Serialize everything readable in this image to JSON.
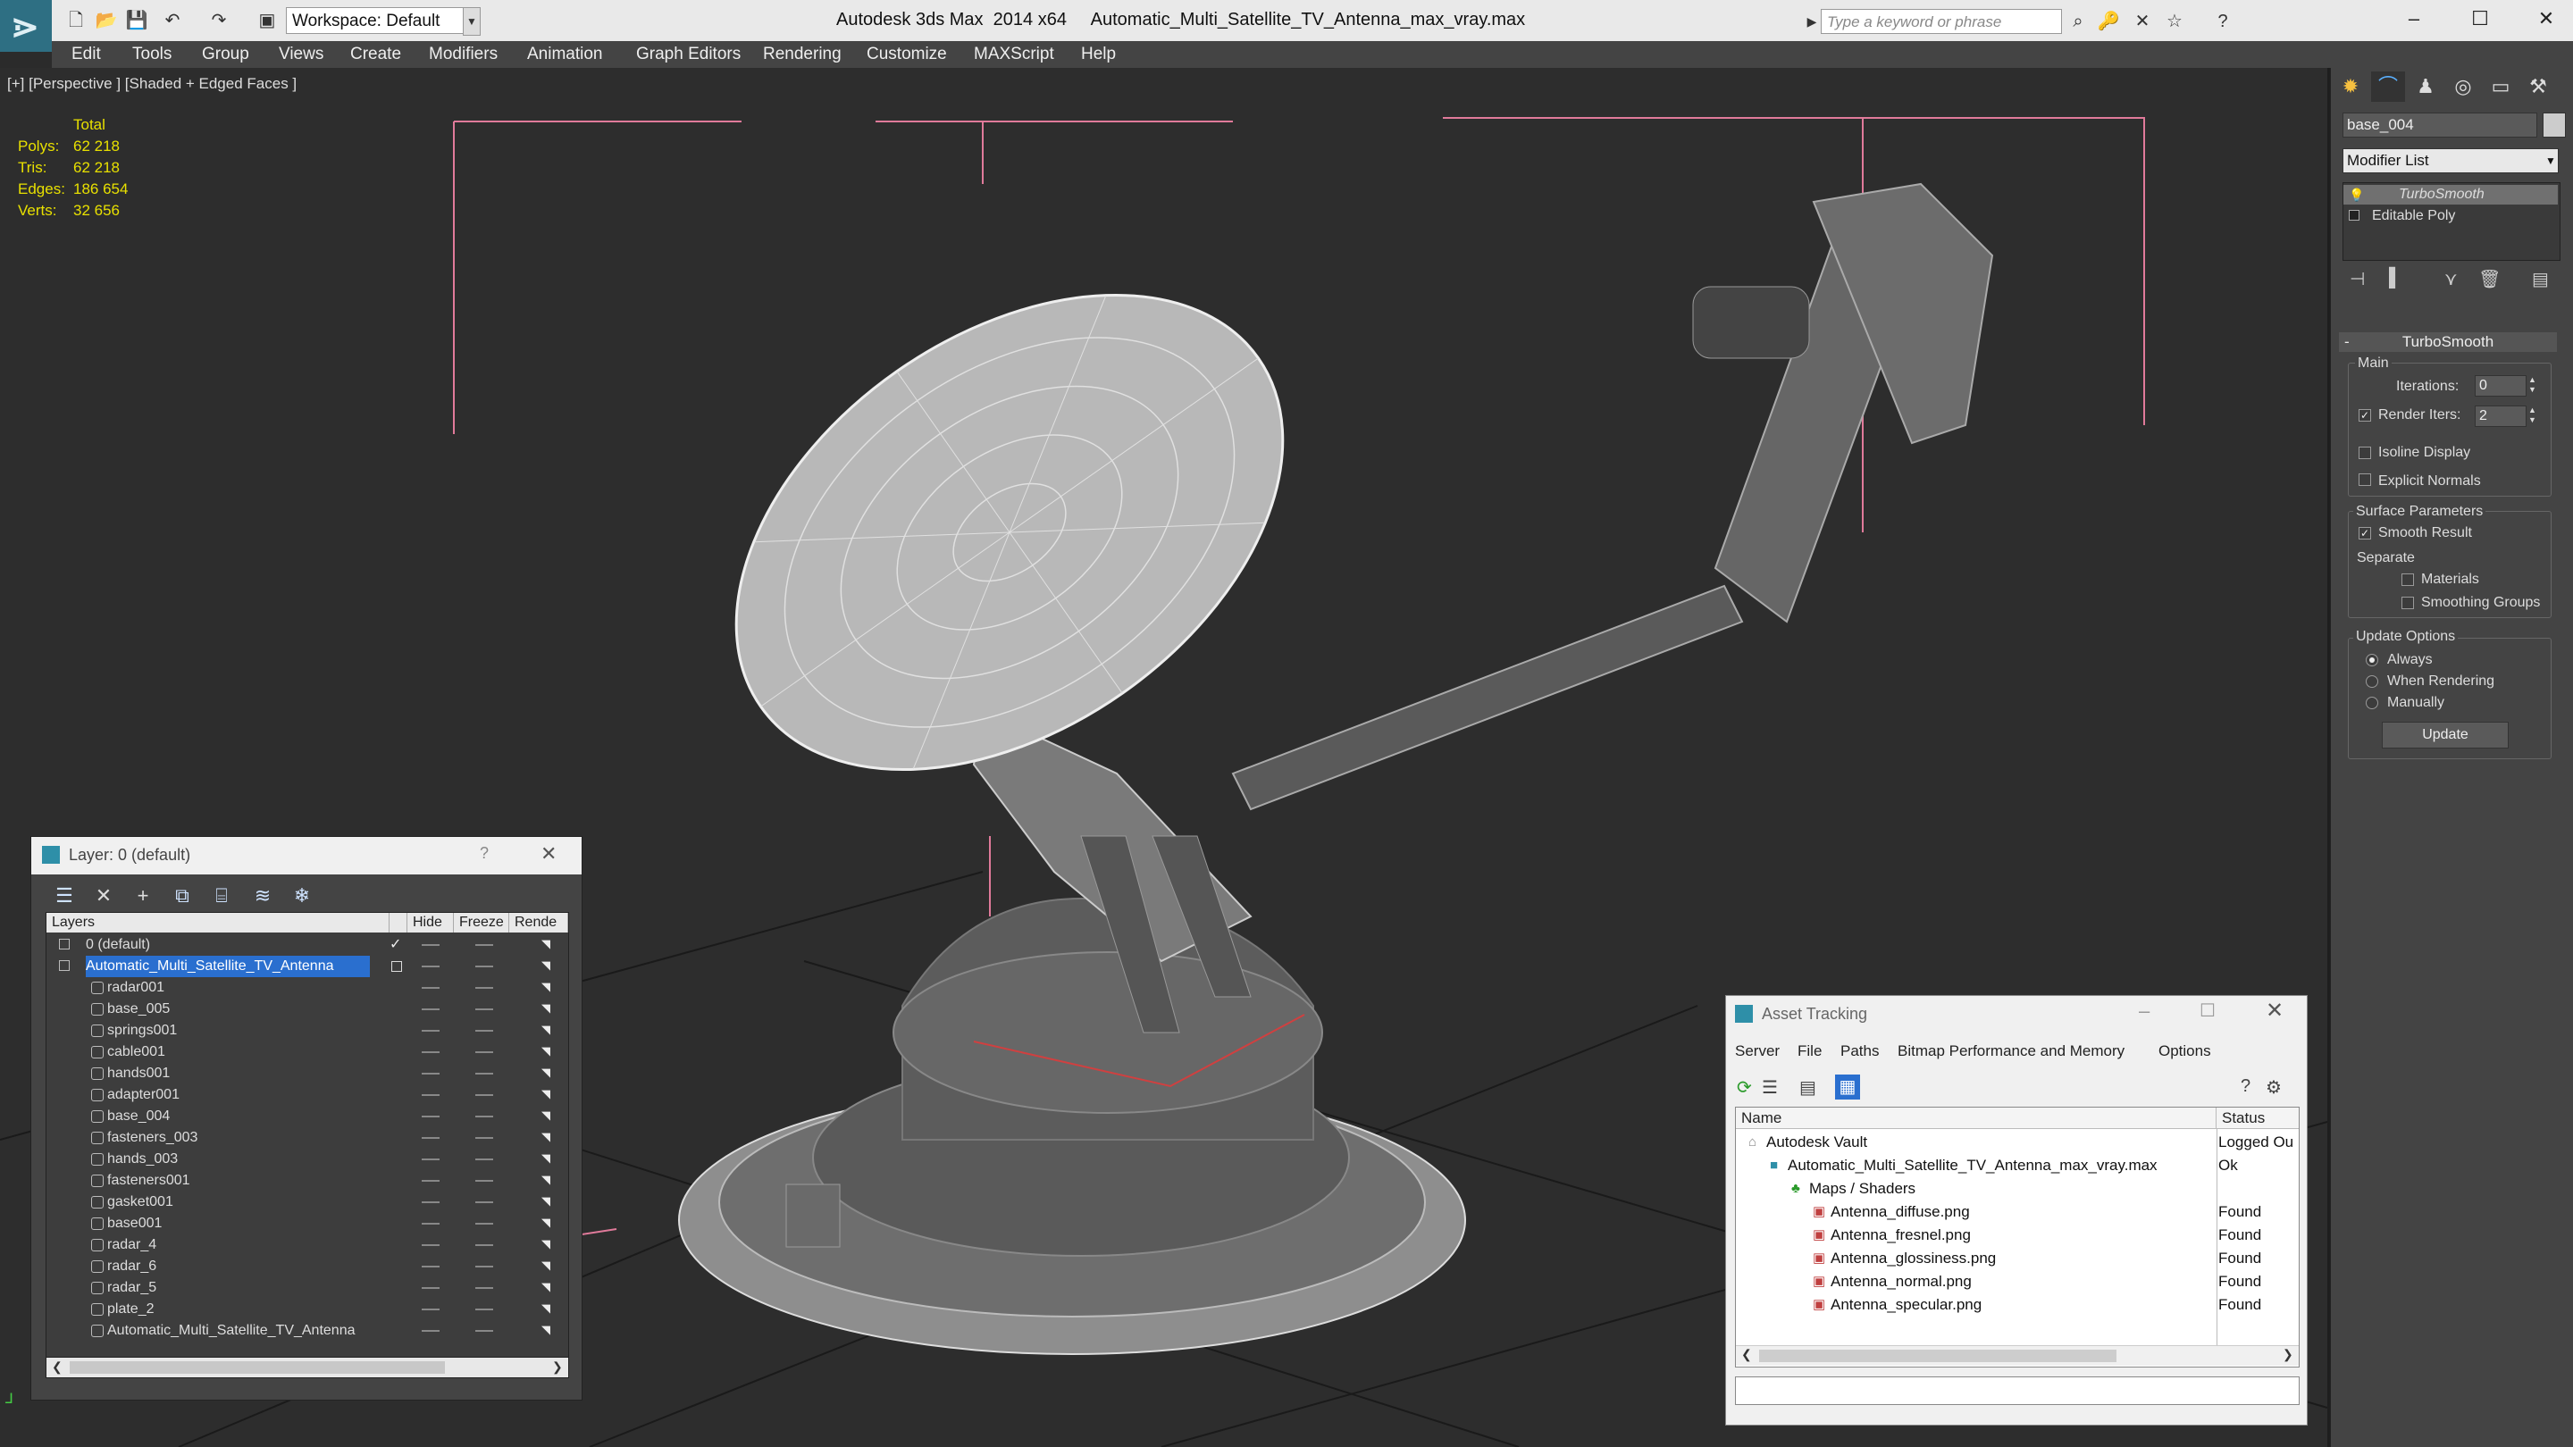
{
  "window": {
    "app_title": "Autodesk 3ds Max  2014 x64",
    "file_title": "Automatic_Multi_Satellite_TV_Antenna_max_vray.max",
    "workspace": "Workspace: Default",
    "search_placeholder": "Type a keyword or phrase"
  },
  "menu": [
    "Edit",
    "Tools",
    "Group",
    "Views",
    "Create",
    "Modifiers",
    "Animation",
    "Graph Editors",
    "Rendering",
    "Customize",
    "MAXScript",
    "Help"
  ],
  "viewport": {
    "label": "[+] [Perspective ] [Shaded + Edged Faces ]",
    "stats": {
      "header": "Total",
      "rows": [
        {
          "k": "Polys:",
          "v": "62 218"
        },
        {
          "k": "Tris:",
          "v": "62 218"
        },
        {
          "k": "Edges:",
          "v": "186 654"
        },
        {
          "k": "Verts:",
          "v": "32 656"
        }
      ]
    }
  },
  "command_panel": {
    "object_name": "base_004",
    "modifier_list": "Modifier List",
    "stack": [
      "TurboSmooth",
      "Editable Poly"
    ],
    "rollout_title": "TurboSmooth",
    "main_group": "Main",
    "iterations_label": "Iterations:",
    "iterations_value": "0",
    "render_iters_label": "Render Iters:",
    "render_iters_value": "2",
    "isoline": "Isoline Display",
    "explicit_normals": "Explicit Normals",
    "surface_params": "Surface Parameters",
    "smooth_result": "Smooth Result",
    "separate": "Separate",
    "materials": "Materials",
    "smoothing_groups": "Smoothing Groups",
    "update_options": "Update Options",
    "always": "Always",
    "when_rendering": "When Rendering",
    "manually": "Manually",
    "update_button": "Update"
  },
  "layer_dialog": {
    "title": "Layer: 0 (default)",
    "help": "?",
    "columns": [
      "Layers",
      "Hide",
      "Freeze",
      "Rende"
    ],
    "layers": [
      {
        "name": "0 (default)",
        "indent": 0,
        "type": "layer",
        "checked": true
      },
      {
        "name": "Automatic_Multi_Satellite_TV_Antenna",
        "indent": 0,
        "type": "layer",
        "selected": true
      },
      {
        "name": "radar001",
        "indent": 1,
        "type": "object"
      },
      {
        "name": "base_005",
        "indent": 1,
        "type": "object"
      },
      {
        "name": "springs001",
        "indent": 1,
        "type": "object"
      },
      {
        "name": "cable001",
        "indent": 1,
        "type": "object"
      },
      {
        "name": "hands001",
        "indent": 1,
        "type": "object"
      },
      {
        "name": "adapter001",
        "indent": 1,
        "type": "object"
      },
      {
        "name": "base_004",
        "indent": 1,
        "type": "object"
      },
      {
        "name": "fasteners_003",
        "indent": 1,
        "type": "object"
      },
      {
        "name": "hands_003",
        "indent": 1,
        "type": "object"
      },
      {
        "name": "fasteners001",
        "indent": 1,
        "type": "object"
      },
      {
        "name": "gasket001",
        "indent": 1,
        "type": "object"
      },
      {
        "name": "base001",
        "indent": 1,
        "type": "object"
      },
      {
        "name": "radar_4",
        "indent": 1,
        "type": "object"
      },
      {
        "name": "radar_6",
        "indent": 1,
        "type": "object"
      },
      {
        "name": "radar_5",
        "indent": 1,
        "type": "object"
      },
      {
        "name": "plate_2",
        "indent": 1,
        "type": "object"
      },
      {
        "name": "Automatic_Multi_Satellite_TV_Antenna",
        "indent": 1,
        "type": "object"
      }
    ]
  },
  "asset_dialog": {
    "title": "Asset Tracking",
    "menu": [
      "Server",
      "File",
      "Paths",
      "Bitmap Performance and Memory",
      "Options"
    ],
    "columns": [
      "Name",
      "Status"
    ],
    "rows": [
      {
        "name": "Autodesk Vault",
        "status": "Logged Ou",
        "indent": 0,
        "icon": "vault"
      },
      {
        "name": "Automatic_Multi_Satellite_TV_Antenna_max_vray.max",
        "status": "Ok",
        "indent": 1,
        "icon": "max"
      },
      {
        "name": "Maps / Shaders",
        "status": "",
        "indent": 2,
        "icon": "maps"
      },
      {
        "name": "Antenna_diffuse.png",
        "status": "Found",
        "indent": 3,
        "icon": "png"
      },
      {
        "name": "Antenna_fresnel.png",
        "status": "Found",
        "indent": 3,
        "icon": "png"
      },
      {
        "name": "Antenna_glossiness.png",
        "status": "Found",
        "indent": 3,
        "icon": "png"
      },
      {
        "name": "Antenna_normal.png",
        "status": "Found",
        "indent": 3,
        "icon": "png"
      },
      {
        "name": "Antenna_specular.png",
        "status": "Found",
        "indent": 3,
        "icon": "png"
      }
    ]
  },
  "colors": {
    "stats_text": "#e8e000",
    "selection": "#2a6fcf",
    "viewport_bg": "#2d2d2d"
  }
}
